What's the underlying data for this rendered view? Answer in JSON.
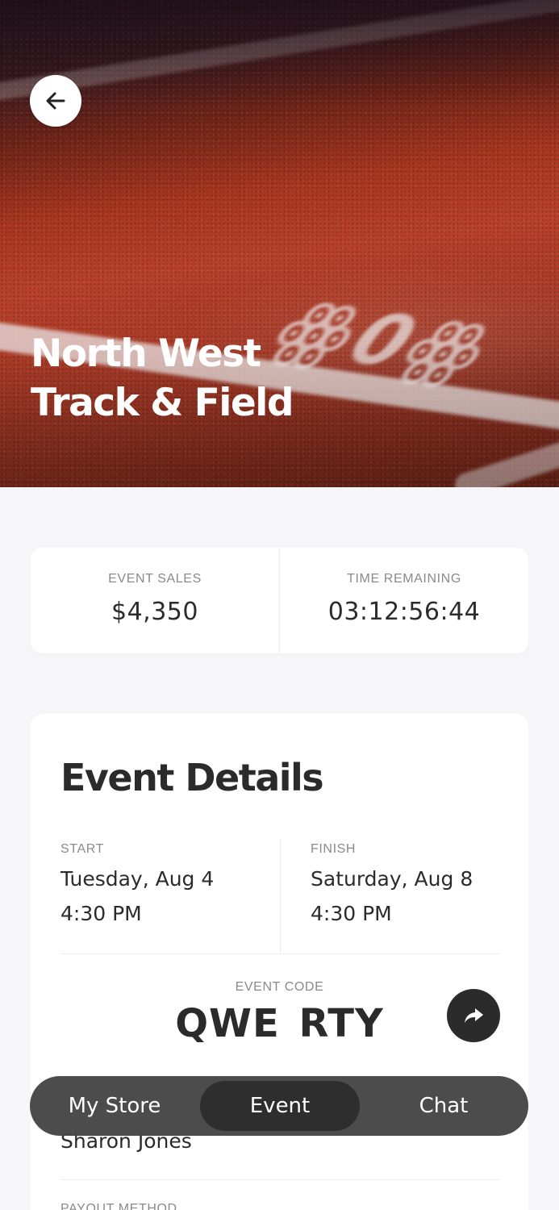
{
  "hero": {
    "title_line1": "North West",
    "title_line2": "Track & Field",
    "background_icon": "running-track-photo"
  },
  "nav": {
    "back_icon": "arrow-left-icon"
  },
  "stats": {
    "sales_label": "EVENT SALES",
    "sales_value": "$4,350",
    "time_label": "TIME REMAINING",
    "time_value": "03:12:56:44"
  },
  "details": {
    "title": "Event Details",
    "start_label": "START",
    "start_date": "Tuesday, Aug 4",
    "start_time": "4:30 PM",
    "finish_label": "FINISH",
    "finish_date": "Saturday, Aug 8",
    "finish_time": "4:30 PM",
    "code_label": "EVENT CODE",
    "code_value": "QWE RTY",
    "share_icon": "share-arrow-icon",
    "contact_value": "Sharon Jones",
    "payout_label": "PAYOUT METHOD"
  },
  "tabbar": {
    "items": [
      {
        "label": "My Store",
        "active": false
      },
      {
        "label": "Event",
        "active": true
      },
      {
        "label": "Chat",
        "active": false
      }
    ]
  },
  "colors": {
    "background": "#f6f6f8",
    "card": "#ffffff",
    "text": "#2b2b2b",
    "muted": "#8a8a8a",
    "nav_bg": "#464646",
    "nav_active": "#2e2e2e"
  }
}
